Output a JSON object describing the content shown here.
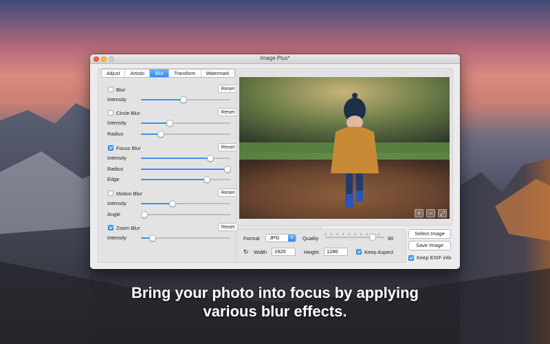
{
  "window": {
    "title": "Image Plus*"
  },
  "tabs": [
    {
      "label": "Adjust",
      "active": false
    },
    {
      "label": "Artistic",
      "active": false
    },
    {
      "label": "Blur",
      "active": true
    },
    {
      "label": "Transform",
      "active": false
    },
    {
      "label": "Watermark",
      "active": false
    }
  ],
  "effects": {
    "blur": {
      "label": "Blur",
      "checked": false,
      "reset": "Reset",
      "intensity_label": "Intensity",
      "intensity": 0.48
    },
    "circle_blur": {
      "label": "Circle Blur",
      "checked": false,
      "reset": "Reset",
      "intensity_label": "Intensity",
      "intensity": 0.32,
      "radius_label": "Radius",
      "radius": 0.22
    },
    "focus_blur": {
      "label": "Focus Blur",
      "checked": true,
      "reset": "Reset",
      "intensity_label": "Intensity",
      "intensity": 0.78,
      "radius_label": "Radius",
      "radius": 0.97,
      "edge_label": "Edge",
      "edge": 0.74
    },
    "motion_blur": {
      "label": "Motion Blur",
      "checked": false,
      "reset": "Reset",
      "intensity_label": "Intensity",
      "intensity": 0.35,
      "angle_label": "Angle",
      "angle": 0.04
    },
    "zoom_blur": {
      "label": "Zoom Blur",
      "checked": true,
      "reset": "Reset",
      "intensity_label": "Intensity",
      "intensity": 0.13
    }
  },
  "zoom_controls": {
    "zoom_in": "+",
    "zoom_out": "−",
    "fit": "⤢"
  },
  "output": {
    "format_label": "Format",
    "format_value": "JPG",
    "quality_label": "Quality",
    "quality_value": "80",
    "width_label": "Width",
    "width_value": "1920",
    "height_label": "Height",
    "height_value": "1280",
    "keep_aspect_label": "Keep Aspect",
    "keep_aspect": true
  },
  "actions": {
    "select_image": "Select Image",
    "save_image": "Save Image",
    "keep_exif_label": "Keep EXIF info",
    "keep_exif": true
  },
  "caption": {
    "line1": "Bring your photo into focus by applying",
    "line2": "various blur effects."
  },
  "colors": {
    "accent": "#2c8af7",
    "window_bg": "#ececec"
  }
}
